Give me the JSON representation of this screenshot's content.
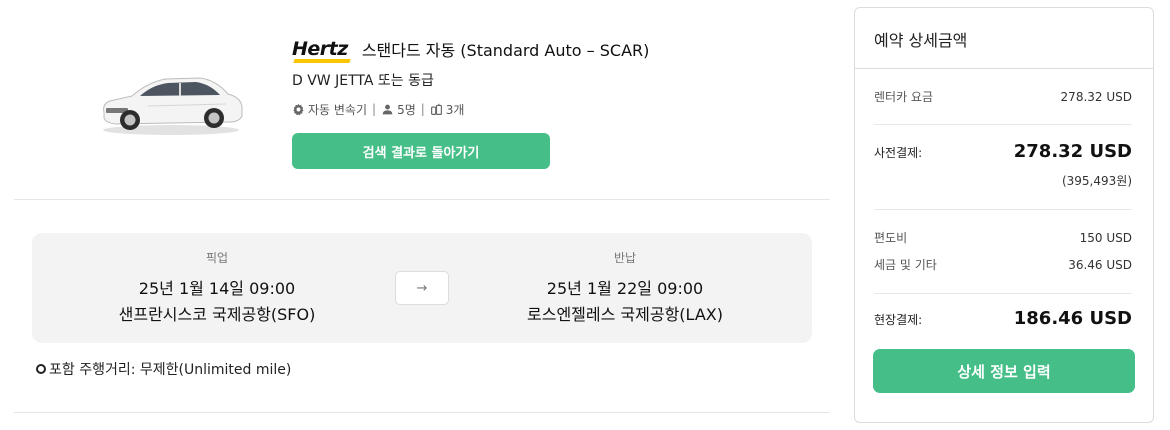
{
  "car": {
    "brand": "Hertz",
    "title": "스탠다드 자동 (Standard Auto – SCAR)",
    "model": "D VW JETTA 또는 동급",
    "transmission": "자동 변속기",
    "seats": "5명",
    "bags": "3개",
    "back_button": "검색 결과로 돌아가기"
  },
  "route": {
    "pickup": {
      "label": "픽업",
      "date": "25년 1월 14일 09:00",
      "place": "샌프란시스코 국제공항(SFO)"
    },
    "return": {
      "label": "반납",
      "date": "25년 1월 22일 09:00",
      "place": "로스엔젤레스 국제공항(LAX)"
    },
    "arrow": "→"
  },
  "mileage": "포함 주행거리: 무제한(Unlimited mile)",
  "price_panel": {
    "title": "예약 상세금액",
    "rental_fee_label": "렌터카 요금",
    "rental_fee_value": "278.32 USD",
    "prepay_label": "사전결제:",
    "prepay_value": "278.32 USD",
    "prepay_krw": "(395,493원)",
    "one_way_label": "편도비",
    "one_way_value": "150 USD",
    "tax_label": "세금 및 기타",
    "tax_value": "36.46 USD",
    "onsite_label": "현장결제:",
    "onsite_value": "186.46 USD",
    "cta": "상세 정보 입력"
  },
  "colors": {
    "accent": "#45bf87",
    "brand_yellow": "#f7c600"
  },
  "icons": [
    "car-image",
    "gear-icon",
    "person-icon",
    "luggage-icon",
    "arrow-right-icon",
    "circle-bullet-icon"
  ]
}
